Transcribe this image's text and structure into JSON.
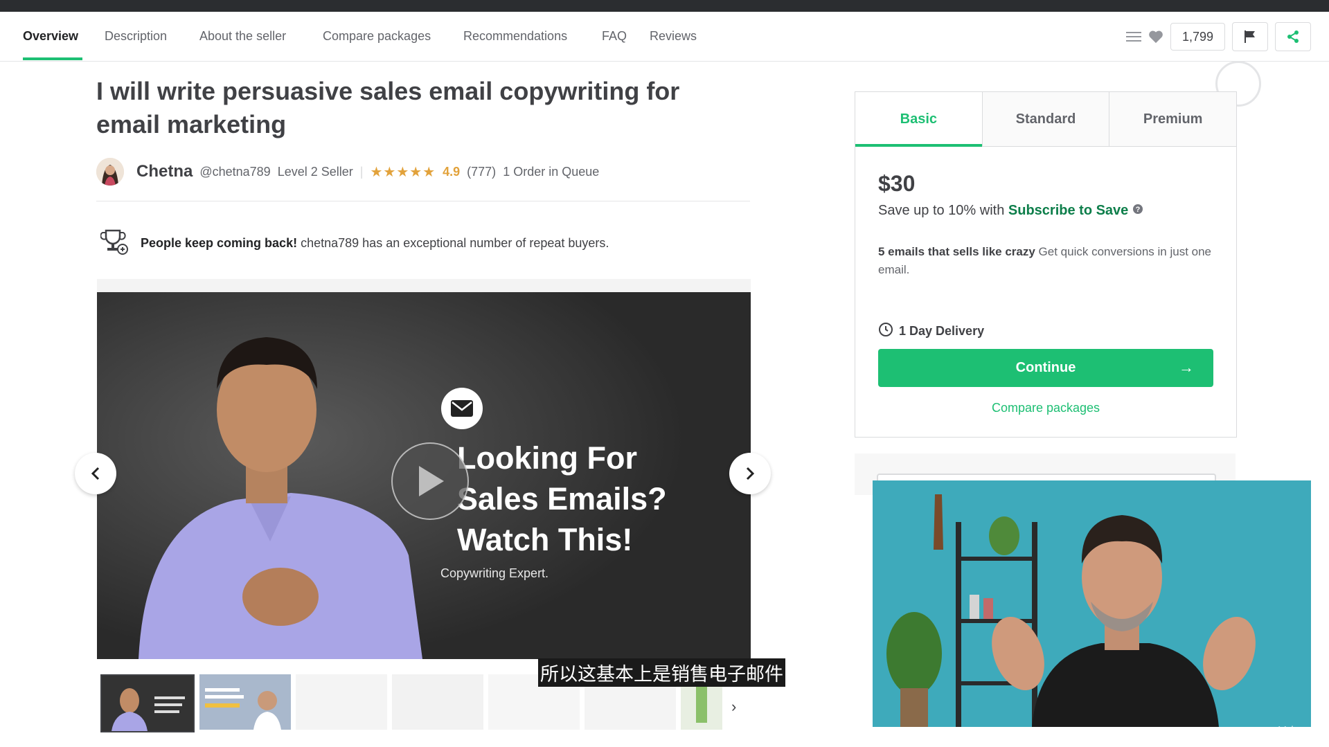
{
  "nav": {
    "tabs": [
      {
        "label": "Overview",
        "active": true
      },
      {
        "label": "Description"
      },
      {
        "label": "About the seller"
      },
      {
        "label": "Compare packages"
      },
      {
        "label": "Recommendations"
      },
      {
        "label": "FAQ"
      },
      {
        "label": "Reviews"
      }
    ],
    "like_count": "1,799",
    "icons": [
      "menu-icon",
      "heart-icon",
      "flag-icon",
      "share-icon"
    ]
  },
  "gig": {
    "title": "I will write persuasive sales email copywriting for email marketing",
    "seller_name": "Chetna",
    "seller_handle": "@chetna789",
    "seller_level": "Level 2 Seller",
    "rating": "4.9",
    "reviews": "(777)",
    "queue": "1 Order in Queue",
    "repeat_bold": "People keep coming back!",
    "repeat_text": "chetna789 has an exceptional number of repeat buyers."
  },
  "video": {
    "headline_lines": [
      "Looking For",
      "Sales Emails?",
      "Watch This!"
    ],
    "sub": "Copywriting Expert.",
    "subtitle": "所以这基本上是销售电子邮件"
  },
  "package": {
    "tabs": [
      "Basic",
      "Standard",
      "Premium"
    ],
    "active_tab": "Basic",
    "price": "$30",
    "save_prefix": "Save up to 10% with",
    "save_link": "Subscribe to Save",
    "desc_bold": "5 emails that sells like crazy",
    "desc_text": "Get quick conversions in just one email.",
    "delivery": "1 Day Delivery",
    "continue_label": "Continue",
    "compare_label": "Compare packages"
  },
  "watermark": "Udemy",
  "colors": {
    "accent": "#1dbf73",
    "star": "#e2a23b",
    "text": "#404145"
  }
}
